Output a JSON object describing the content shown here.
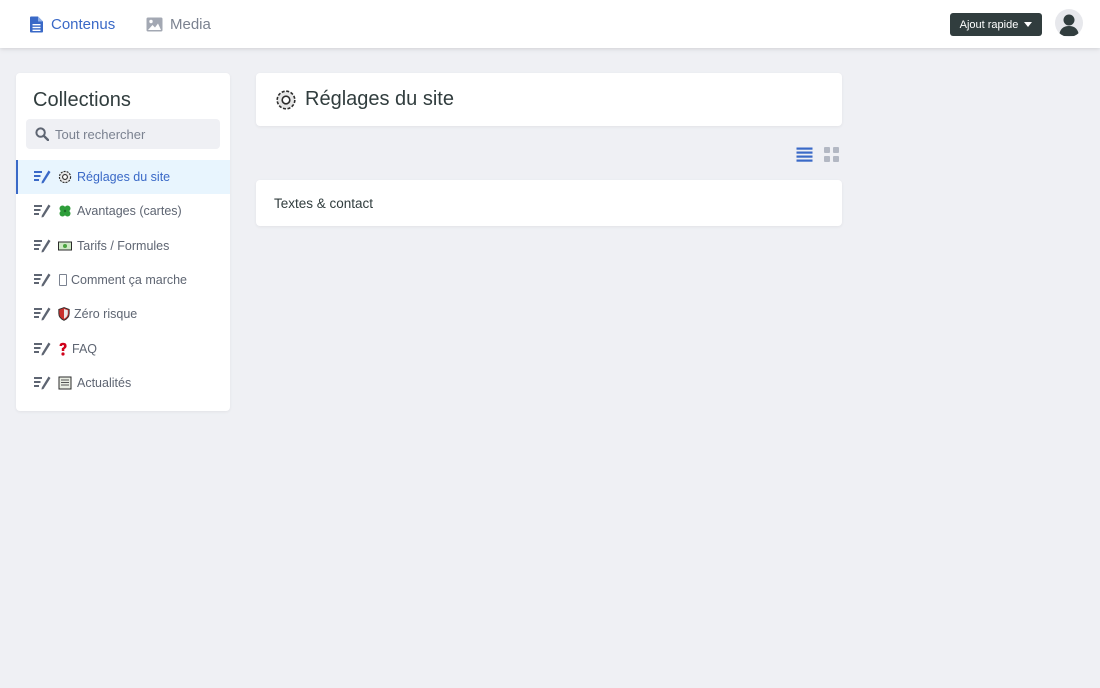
{
  "topbar": {
    "nav": [
      {
        "label": "Contenus",
        "icon": "document-icon",
        "active": true
      },
      {
        "label": "Media",
        "icon": "image-icon",
        "active": false
      }
    ],
    "quick_add_label": "Ajout rapide",
    "avatar": "user-avatar-icon"
  },
  "sidebar": {
    "title": "Collections",
    "search_placeholder": "Tout rechercher",
    "items": [
      {
        "label": "Réglages du site",
        "icon": "gear-emoji-icon",
        "active": true
      },
      {
        "label": "Avantages (cartes)",
        "icon": "clover-emoji-icon",
        "active": false
      },
      {
        "label": "Tarifs / Formules",
        "icon": "banknote-emoji-icon",
        "active": false
      },
      {
        "label": "Comment ça marche",
        "icon": "missing-glyph-icon",
        "active": false
      },
      {
        "label": "Zéro risque",
        "icon": "shield-emoji-icon",
        "active": false
      },
      {
        "label": "FAQ",
        "icon": "question-emoji-icon",
        "active": false
      },
      {
        "label": "Actualités",
        "icon": "newspaper-emoji-icon",
        "active": false
      }
    ]
  },
  "main": {
    "title": "Réglages du site",
    "entries": [
      {
        "label": "Textes & contact"
      }
    ]
  },
  "colors": {
    "accent": "#3a69c7",
    "dark": "#313d3e",
    "background": "#eff0f4",
    "active_row": "#e8f5fe",
    "muted": "#7b8290"
  }
}
